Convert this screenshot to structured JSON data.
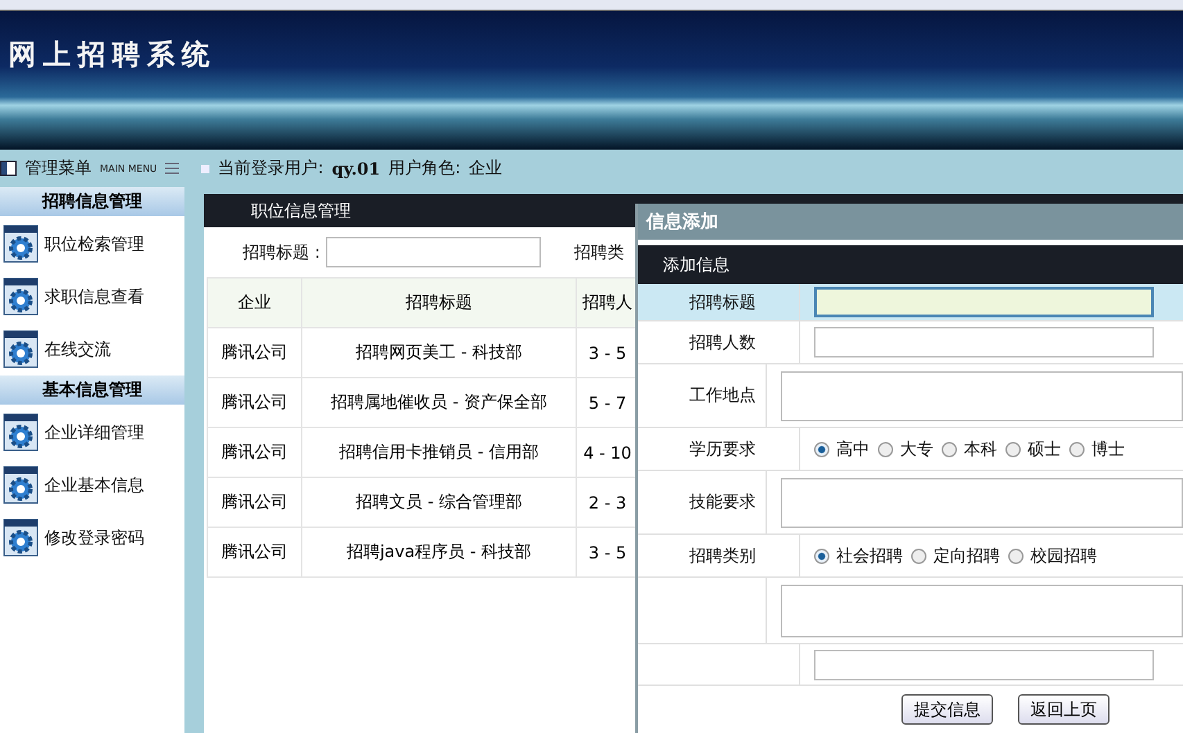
{
  "header": {
    "title": "网上招聘系统"
  },
  "menu_bar": {
    "menu_label": "管理菜单",
    "menu_sub": "MAIN MENU",
    "user_label": "当前登录用户:",
    "user": "qy.01",
    "role_label": "用户角色:",
    "role": "企业"
  },
  "sidebar": {
    "groups": [
      {
        "title": "招聘信息管理",
        "items": [
          "职位检索管理",
          "求职信息查看",
          "在线交流"
        ]
      },
      {
        "title": "基本信息管理",
        "items": [
          "企业详细管理",
          "企业基本信息",
          "修改登录密码"
        ]
      }
    ]
  },
  "panel": {
    "title": "职位信息管理",
    "search_label": "招聘标题 :",
    "search_label_2": "招聘类",
    "columns": [
      "企业",
      "招聘标题",
      "招聘人"
    ],
    "rows": [
      [
        "腾讯公司",
        "招聘网页美工 - 科技部",
        "3 - 5"
      ],
      [
        "腾讯公司",
        "招聘属地催收员 - 资产保全部",
        "5 - 7"
      ],
      [
        "腾讯公司",
        "招聘信用卡推销员 - 信用部",
        "4 - 10"
      ],
      [
        "腾讯公司",
        "招聘文员 - 综合管理部",
        "2 - 3"
      ],
      [
        "腾讯公司",
        "招聘java程序员 - 科技部",
        "3 - 5"
      ]
    ]
  },
  "dialog": {
    "title": "信息添加",
    "section": "添加信息",
    "fields": [
      {
        "kind": "input",
        "label": "招聘标题",
        "focused": true
      },
      {
        "kind": "input",
        "label": "招聘人数",
        "focused": false
      },
      {
        "kind": "textarea",
        "label": "工作地点",
        "focused": false
      },
      {
        "kind": "radio",
        "label": "学历要求",
        "options": [
          {
            "label": "高中",
            "selected": true
          },
          {
            "label": "大专",
            "selected": false
          },
          {
            "label": "本科",
            "selected": false
          },
          {
            "label": "硕士",
            "selected": false
          },
          {
            "label": "博士",
            "selected": false
          }
        ]
      },
      {
        "kind": "textarea",
        "label": "技能要求",
        "focused": false
      },
      {
        "kind": "radio",
        "label": "招聘类别",
        "options": [
          {
            "label": "社会招聘",
            "selected": true
          },
          {
            "label": "定向招聘",
            "selected": false
          },
          {
            "label": "校园招聘",
            "selected": false
          }
        ]
      },
      {
        "kind": "textarea",
        "focused": false
      },
      {
        "kind": "input",
        "focused": false
      }
    ],
    "buttons": [
      "提交信息",
      "返回上页"
    ]
  }
}
